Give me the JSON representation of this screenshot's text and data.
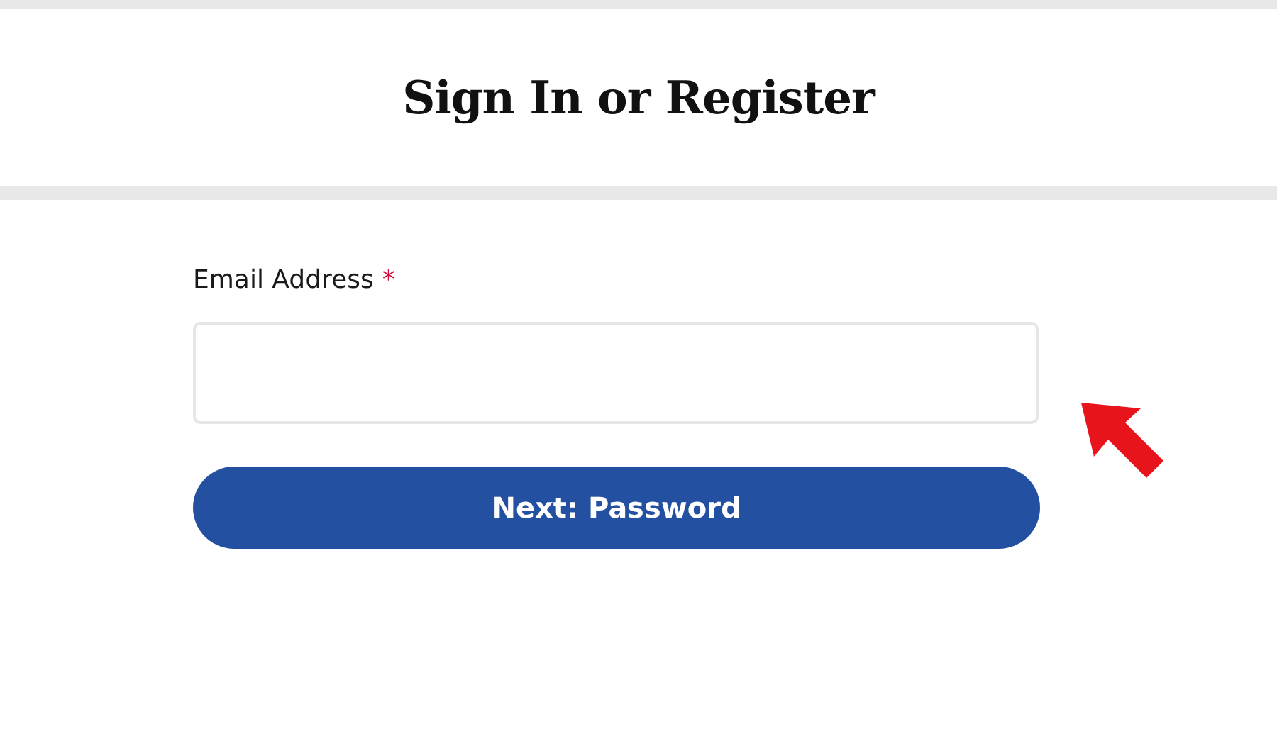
{
  "header": {
    "title": "Sign In or Register"
  },
  "form": {
    "email": {
      "label": "Email Address",
      "required_mark": "*"
    },
    "submit": {
      "label": "Next: Password"
    }
  },
  "annotation": {
    "kind": "arrow"
  }
}
